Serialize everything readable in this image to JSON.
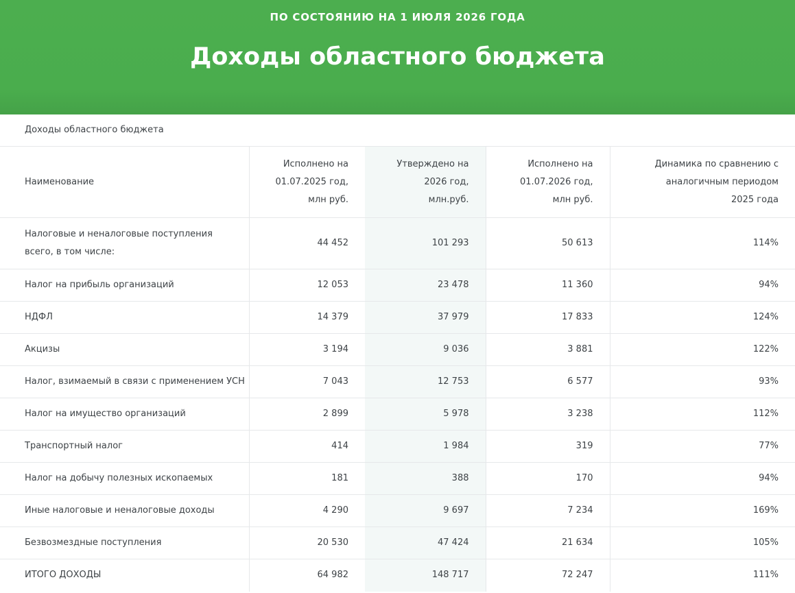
{
  "header": {
    "kicker": "ПО СОСТОЯНИЮ НА 1 ИЮЛЯ 2026 ГОДА",
    "title": "Доходы областного бюджета"
  },
  "table": {
    "caption": "Доходы областного бюджета",
    "columns": [
      "Наименование",
      "Исполнено на 01.07.2025 год, млн руб.",
      "Утверждено на 2026 год, млн.руб.",
      "Исполнено на 01.07.2026 год, млн руб.",
      "Динамика по сравнению с аналогичным периодом 2025 года"
    ],
    "rows": [
      [
        "Налоговые и неналоговые поступления всего, в том числе:",
        "44 452",
        "101 293",
        "50 613",
        "114%"
      ],
      [
        "Налог на прибыль организаций",
        "12 053",
        "23 478",
        "11 360",
        "94%"
      ],
      [
        "НДФЛ",
        "14 379",
        "37 979",
        "17 833",
        "124%"
      ],
      [
        "Акцизы",
        "3 194",
        "9 036",
        "3 881",
        "122%"
      ],
      [
        "Налог, взимаемый в связи с применением УСН",
        "7 043",
        "12 753",
        "6 577",
        "93%"
      ],
      [
        "Налог на имущество организаций",
        "2 899",
        "5 978",
        "3 238",
        "112%"
      ],
      [
        "Транспортный налог",
        "414",
        "1 984",
        "319",
        "77%"
      ],
      [
        "Налог на добычу полезных ископаемых",
        "181",
        "388",
        "170",
        "94%"
      ],
      [
        "Иные налоговые и неналоговые доходы",
        "4 290",
        "9 697",
        "7 234",
        "169%"
      ],
      [
        "Безвозмездные поступления",
        "20 530",
        "47 424",
        "21 634",
        "105%"
      ],
      [
        "ИТОГО ДОХОДЫ",
        "64 982",
        "148 717",
        "72 247",
        "111%"
      ]
    ]
  },
  "colors": {
    "header_green": "#4cae4f",
    "shaded_column": "#f3f8f7",
    "border": "#e6e8ea",
    "text": "#3d4246"
  }
}
